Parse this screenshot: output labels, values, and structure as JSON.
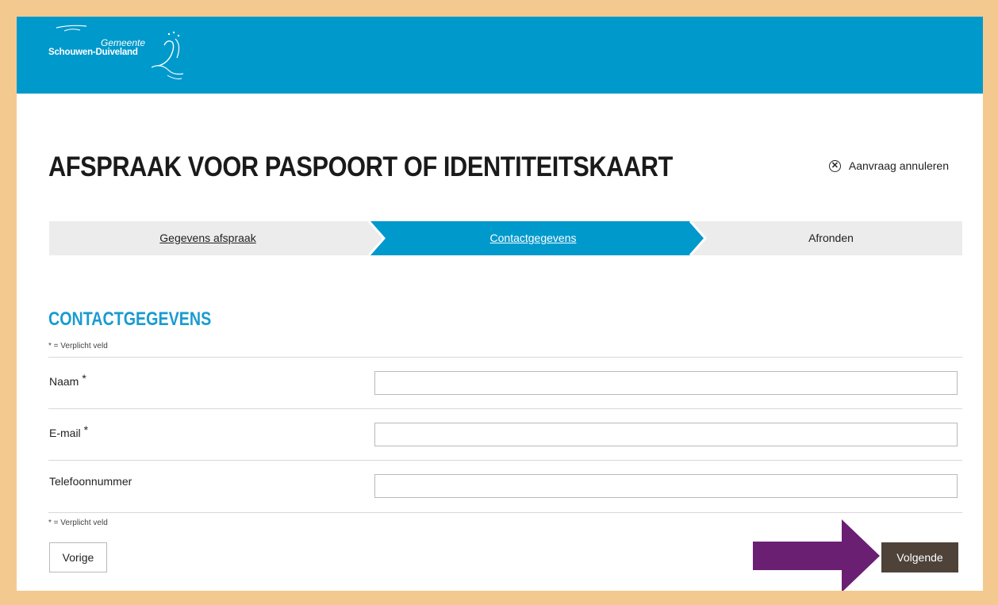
{
  "header": {
    "logo_line1": "Gemeente",
    "logo_line2": "Schouwen-Duiveland"
  },
  "page": {
    "title": "AFSPRAAK VOOR PASPOORT OF IDENTITEITSKAART",
    "cancel_label": "Aanvraag annuleren"
  },
  "steps": [
    {
      "label": "Gegevens afspraak",
      "state": "done"
    },
    {
      "label": "Contactgegevens",
      "state": "active"
    },
    {
      "label": "Afronden",
      "state": "pending"
    }
  ],
  "form": {
    "section_title": "CONTACTGEGEVENS",
    "required_note": "* = Verplicht veld",
    "fields": [
      {
        "label": "Naam",
        "required": "*",
        "value": ""
      },
      {
        "label": "E-mail",
        "required": "*",
        "value": ""
      },
      {
        "label": "Telefoonnummer",
        "required": "",
        "value": ""
      }
    ]
  },
  "buttons": {
    "prev_label": "Vorige",
    "next_label": "Volgende"
  },
  "colors": {
    "header": "#0099cc",
    "accent": "#1a9bd0",
    "step_inactive": "#ececec",
    "next_button": "#4e4239",
    "annotation_arrow": "#6a1f73",
    "border_frame": "#f4c98f"
  },
  "icons": {
    "cancel": "close-circle-icon",
    "logo": "gemeente-logo-icon",
    "annotation": "right-arrow-icon"
  }
}
